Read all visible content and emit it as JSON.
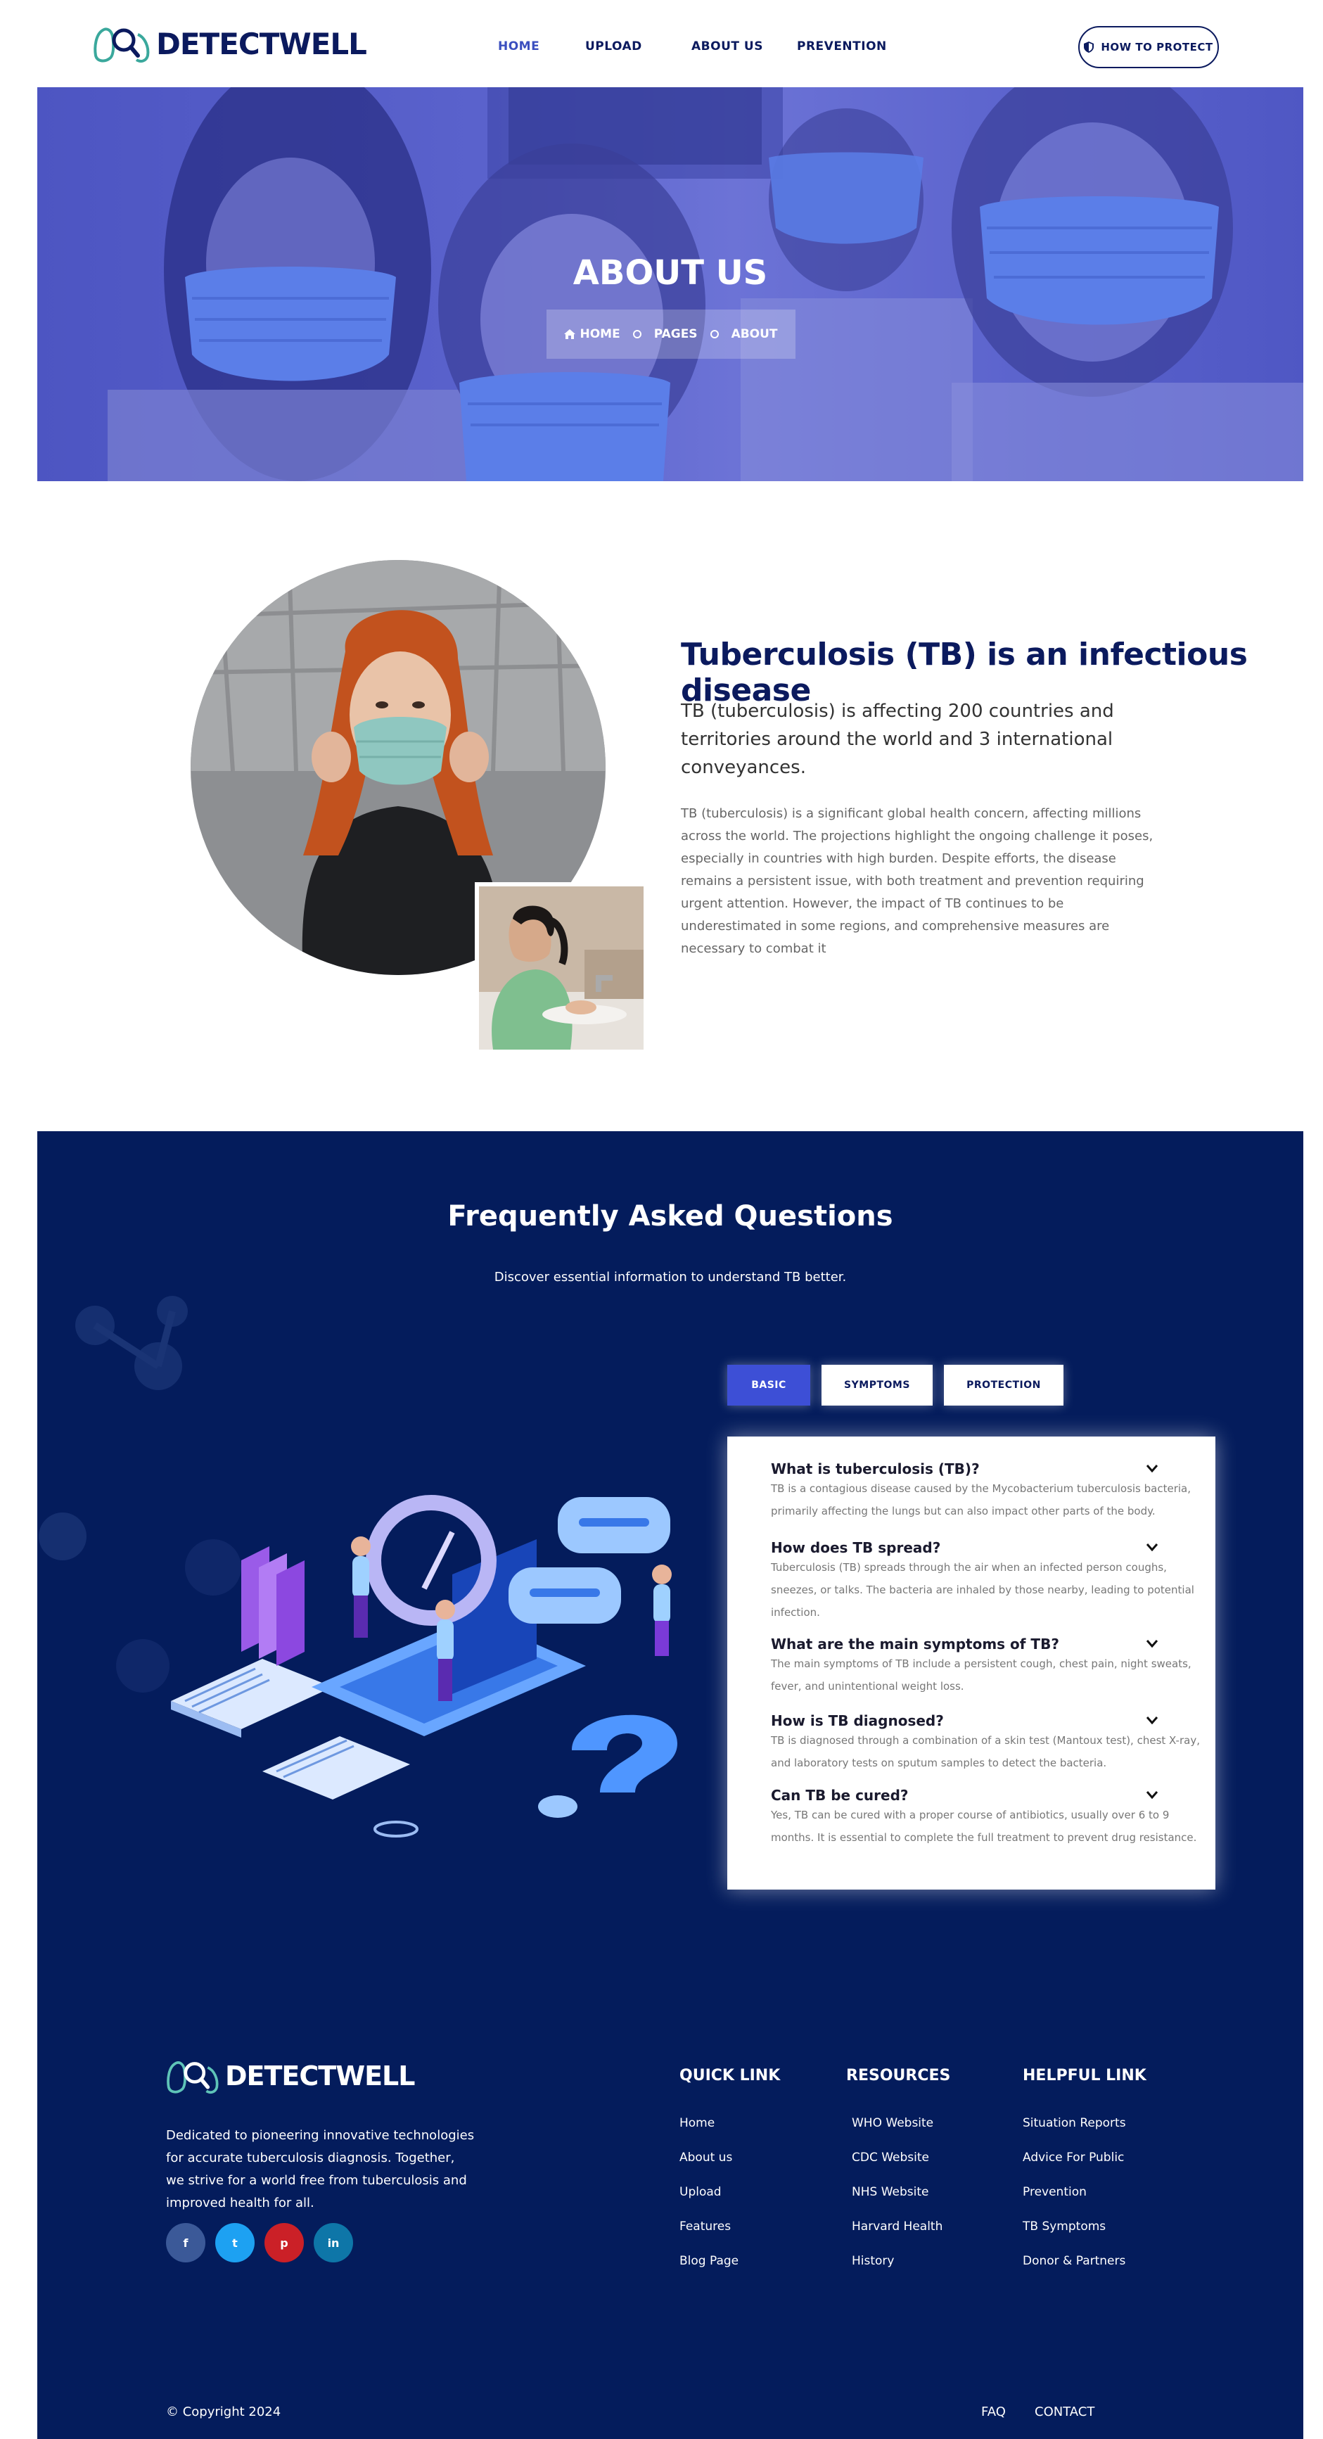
{
  "header": {
    "logo_text": "DETECTWELL",
    "nav": [
      {
        "label": "HOME",
        "active": true
      },
      {
        "label": "UPLOAD",
        "active": false
      },
      {
        "label": "ABOUT US",
        "active": false
      },
      {
        "label": "PREVENTION",
        "active": false
      }
    ],
    "cta_label": "HOW TO PROTECT"
  },
  "hero": {
    "title": "ABOUT US",
    "breadcrumb": [
      "HOME",
      "PAGES",
      "ABOUT"
    ]
  },
  "about": {
    "heading": "Tuberculosis (TB) is an infectious disease",
    "lead": "TB (tuberculosis) is affecting 200 countries and territories around the world and 3 international conveyances.",
    "body": "TB (tuberculosis) is a significant global health concern, affecting millions across the world. The projections highlight the ongoing challenge it poses, especially in countries with high burden. Despite efforts, the disease remains a persistent issue, with both treatment and prevention requiring urgent attention. However, the impact of TB continues to be underestimated in some regions, and comprehensive measures are necessary to combat it"
  },
  "faq": {
    "title": "Frequently Asked Questions",
    "subtitle": "Discover essential information to understand TB better.",
    "tabs": [
      {
        "label": "BASIC",
        "active": true
      },
      {
        "label": "SYMPTOMS",
        "active": false
      },
      {
        "label": "PROTECTION",
        "active": false
      }
    ],
    "items": [
      {
        "q": "What is tuberculosis (TB)?",
        "a": "TB is a contagious disease caused by the Mycobacterium tuberculosis bacteria, primarily affecting the lungs but can also impact other parts of the body."
      },
      {
        "q": "How does TB spread?",
        "a": "Tuberculosis (TB) spreads through the air when an infected person coughs, sneezes, or talks. The bacteria are inhaled by those nearby, leading to potential infection."
      },
      {
        "q": "What are the main symptoms of TB?",
        "a": "The main symptoms of TB include a persistent cough, chest pain, night sweats, fever, and unintentional weight loss."
      },
      {
        "q": "How is TB diagnosed?",
        "a": "TB is diagnosed through a combination of a skin test (Mantoux test), chest X-ray, and laboratory tests on sputum samples to detect the bacteria."
      },
      {
        "q": "Can TB be cured?",
        "a": "Yes, TB can be cured with a proper course of antibiotics, usually over 6 to 9 months. It is essential to complete the full treatment to prevent drug resistance."
      }
    ]
  },
  "footer": {
    "logo_text": "DETECTWELL",
    "description": "Dedicated to pioneering innovative technologies for accurate tuberculosis diagnosis. Together, we strive for a world free from tuberculosis and improved health for all.",
    "social": [
      {
        "icon": "facebook-icon",
        "glyph": "f",
        "color": "#3b5998"
      },
      {
        "icon": "twitter-icon",
        "glyph": "t",
        "color": "#1da1f2"
      },
      {
        "icon": "pinterest-icon",
        "glyph": "p",
        "color": "#cb2027"
      },
      {
        "icon": "linkedin-icon",
        "glyph": "in",
        "color": "#0e76a8"
      }
    ],
    "columns": [
      {
        "title": "QUICK LINK",
        "links": [
          "Home",
          "About us",
          "Upload",
          "Features",
          "Blog Page"
        ]
      },
      {
        "title": "RESOURCES",
        "links": [
          "WHO Website",
          "CDC Website",
          "NHS Website",
          "Harvard Health",
          "History"
        ]
      },
      {
        "title": "HELPFUL LINK",
        "links": [
          "Situation Reports",
          "Advice For Public",
          "Prevention",
          "TB Symptoms",
          "Donor & Partners"
        ]
      }
    ],
    "copyright": "© Copyright 2024",
    "bottom_links": [
      "FAQ",
      "CONTACT"
    ]
  },
  "colors": {
    "brand_navy": "#0b1a5e",
    "hero_overlay": "#5a62cc",
    "faq_bg": "#041c5c",
    "accent_blue": "#3d4fd6"
  }
}
